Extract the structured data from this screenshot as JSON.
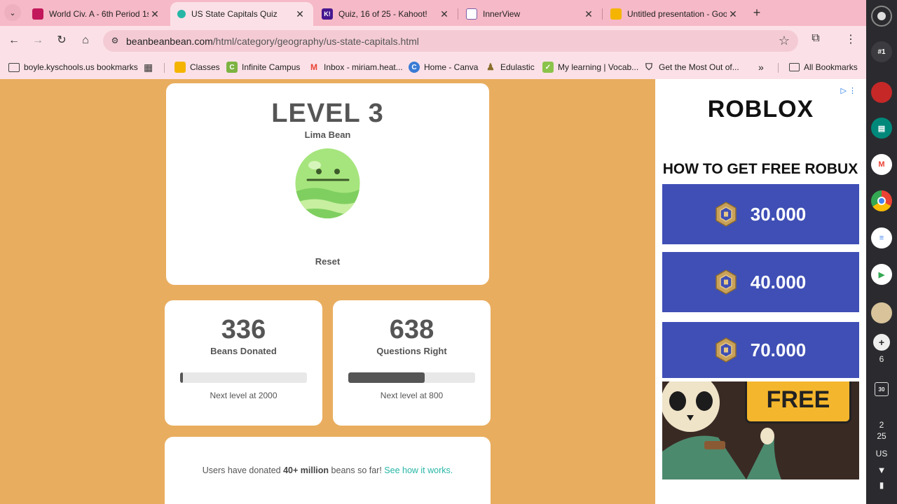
{
  "browser": {
    "tabs": [
      {
        "title": "World Civ. A - 6th Period 1s",
        "color": "#c2185b",
        "icon": "classroom-icon"
      },
      {
        "title": "US State Capitals Quiz",
        "color": "#27b6a6",
        "icon": "bean-icon",
        "active": true
      },
      {
        "title": "Quiz, 16 of 25 - Kahoot!",
        "color": "#46178f",
        "icon": "kahoot-icon",
        "glyph": "K!"
      },
      {
        "title": "InnerView",
        "color": "#7b5ea7",
        "icon": "innerview-icon"
      },
      {
        "title": "Untitled presentation - Goog",
        "color": "#f4b400",
        "icon": "slides-icon"
      }
    ],
    "url_host": "beanbeanbean.com",
    "url_path": "/html/category/geography/us-state-capitals.html",
    "bookmarks": [
      {
        "label": "boyle.kyschools.us bookmarks",
        "icon": "folder-icon"
      },
      {
        "label": "Classes",
        "icon": "classroom-icon",
        "color": "#f4b400"
      },
      {
        "label": "Infinite Campus",
        "icon": "infinite-campus-icon",
        "color": "#7cb342",
        "glyph": "C"
      },
      {
        "label": "Inbox - miriam.heat...",
        "icon": "gmail-icon",
        "color": "#ea4335",
        "glyph": "M"
      },
      {
        "label": "Home - Canva",
        "icon": "canva-icon",
        "color": "#3a7bd5",
        "glyph": "C"
      },
      {
        "label": "Edulastic",
        "icon": "edulastic-icon"
      },
      {
        "label": "My learning | Vocab...",
        "icon": "vocab-icon",
        "color": "#8bc34a",
        "glyph": "✓"
      },
      {
        "label": "Get the Most Out of...",
        "icon": "shield-icon"
      }
    ],
    "all_bookmarks": "All Bookmarks"
  },
  "level": {
    "title": "LEVEL 3",
    "bean_name": "Lima Bean",
    "reset_label": "Reset"
  },
  "stats": {
    "beans": {
      "value": "336",
      "label": "Beans Donated",
      "next": "Next level at 2000",
      "progress": 0.02
    },
    "questions": {
      "value": "638",
      "label": "Questions Right",
      "next": "Next level at 800",
      "progress": 0.6
    }
  },
  "donate": {
    "prefix": "Users have donated ",
    "bold": "40+ million",
    "suffix": " beans so far! ",
    "link": "See how it works."
  },
  "ad": {
    "brand": "ROBLOX",
    "headline": "HOW TO GET FREE ROBUX",
    "offers": [
      "30.000",
      "40.000",
      "70.000"
    ],
    "sign_text": "FREE",
    "color": "#3f4fb5"
  },
  "shelf": {
    "badge": "#1",
    "notifications": "6",
    "calendar_day": "30",
    "time_hour": "2",
    "time_min": "25",
    "locale": "US"
  }
}
